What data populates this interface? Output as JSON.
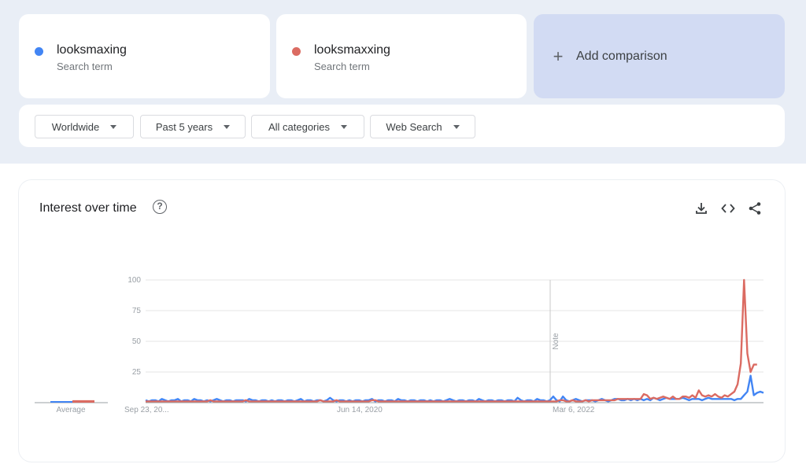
{
  "terms": [
    {
      "name": "looksmaxing",
      "sub": "Search term",
      "color": "#4285f4"
    },
    {
      "name": "looksmaxxing",
      "sub": "Search term",
      "color": "#db6b62"
    }
  ],
  "add_comparison": {
    "icon": "+",
    "label": "Add comparison"
  },
  "filters": [
    {
      "label": "Worldwide"
    },
    {
      "label": "Past 5 years"
    },
    {
      "label": "All categories"
    },
    {
      "label": "Web Search"
    }
  ],
  "panel": {
    "title": "Interest over time",
    "help_icon": "?",
    "tools": [
      "download-icon",
      "embed-icon",
      "share-icon"
    ]
  },
  "chart_data": {
    "type": "line",
    "x_tick_labels": [
      "Sep 23, 20...",
      "Jun 14, 2020",
      "Mar 6, 2022"
    ],
    "y_ticks": [
      25,
      50,
      75,
      100
    ],
    "ylim": [
      0,
      100
    ],
    "note_label": "Note",
    "average_label": "Average",
    "averages": [
      1,
      2
    ],
    "series": [
      {
        "name": "looksmaxing",
        "color": "#4285f4",
        "values": [
          2,
          1,
          2,
          2,
          1,
          3,
          2,
          1,
          2,
          2,
          3,
          1,
          2,
          2,
          1,
          3,
          2,
          2,
          1,
          2,
          1,
          2,
          3,
          2,
          1,
          2,
          2,
          1,
          2,
          2,
          2,
          1,
          3,
          2,
          2,
          1,
          2,
          2,
          1,
          2,
          1,
          2,
          2,
          1,
          2,
          2,
          1,
          2,
          3,
          1,
          2,
          2,
          1,
          2,
          2,
          1,
          2,
          4,
          2,
          1,
          2,
          2,
          1,
          2,
          1,
          2,
          2,
          1,
          2,
          2,
          3,
          1,
          2,
          2,
          1,
          2,
          2,
          1,
          3,
          2,
          2,
          1,
          2,
          2,
          1,
          2,
          2,
          1,
          2,
          1,
          2,
          2,
          1,
          2,
          3,
          2,
          1,
          2,
          2,
          1,
          2,
          2,
          1,
          3,
          2,
          1,
          2,
          2,
          1,
          2,
          2,
          1,
          2,
          2,
          1,
          4,
          2,
          1,
          2,
          2,
          1,
          3,
          2,
          2,
          1,
          2,
          5,
          2,
          1,
          5,
          2,
          1,
          2,
          3,
          2,
          1,
          2,
          2,
          2,
          1,
          2,
          3,
          2,
          1,
          2,
          3,
          3,
          2,
          2,
          3,
          2,
          3,
          2,
          3,
          2,
          3,
          2,
          4,
          3,
          2,
          3,
          4,
          3,
          3,
          3,
          3,
          4,
          3,
          2,
          3,
          3,
          3,
          2,
          3,
          4,
          3,
          3,
          3,
          3,
          3,
          3,
          3,
          2,
          3,
          3,
          6,
          9,
          22,
          6,
          8,
          9,
          8
        ]
      },
      {
        "name": "looksmaxxing",
        "color": "#db6b62",
        "values": [
          1,
          1,
          1,
          1,
          1,
          1,
          1,
          1,
          1,
          1,
          1,
          1,
          1,
          1,
          1,
          1,
          1,
          1,
          1,
          1,
          2,
          1,
          1,
          1,
          1,
          1,
          1,
          1,
          1,
          1,
          1,
          2,
          1,
          1,
          1,
          1,
          1,
          1,
          1,
          1,
          1,
          1,
          1,
          1,
          1,
          1,
          1,
          1,
          1,
          1,
          1,
          1,
          1,
          1,
          2,
          1,
          1,
          1,
          1,
          2,
          1,
          1,
          1,
          1,
          1,
          1,
          1,
          1,
          1,
          1,
          2,
          2,
          1,
          1,
          1,
          1,
          1,
          1,
          1,
          1,
          1,
          1,
          1,
          1,
          1,
          1,
          1,
          1,
          1,
          1,
          1,
          1,
          1,
          1,
          1,
          1,
          1,
          1,
          1,
          1,
          1,
          1,
          1,
          1,
          1,
          1,
          1,
          1,
          1,
          1,
          1,
          1,
          1,
          1,
          1,
          1,
          1,
          1,
          1,
          1,
          1,
          1,
          1,
          1,
          1,
          1,
          1,
          1,
          2,
          2,
          1,
          1,
          2,
          1,
          1,
          1,
          2,
          1,
          2,
          2,
          2,
          2,
          2,
          2,
          2,
          2,
          3,
          3,
          3,
          3,
          3,
          3,
          3,
          3,
          7,
          6,
          3,
          4,
          3,
          4,
          5,
          4,
          3,
          5,
          3,
          3,
          5,
          5,
          4,
          6,
          4,
          10,
          6,
          5,
          6,
          5,
          7,
          5,
          4,
          6,
          5,
          7,
          9,
          15,
          32,
          100,
          40,
          25,
          31,
          31
        ]
      }
    ]
  }
}
